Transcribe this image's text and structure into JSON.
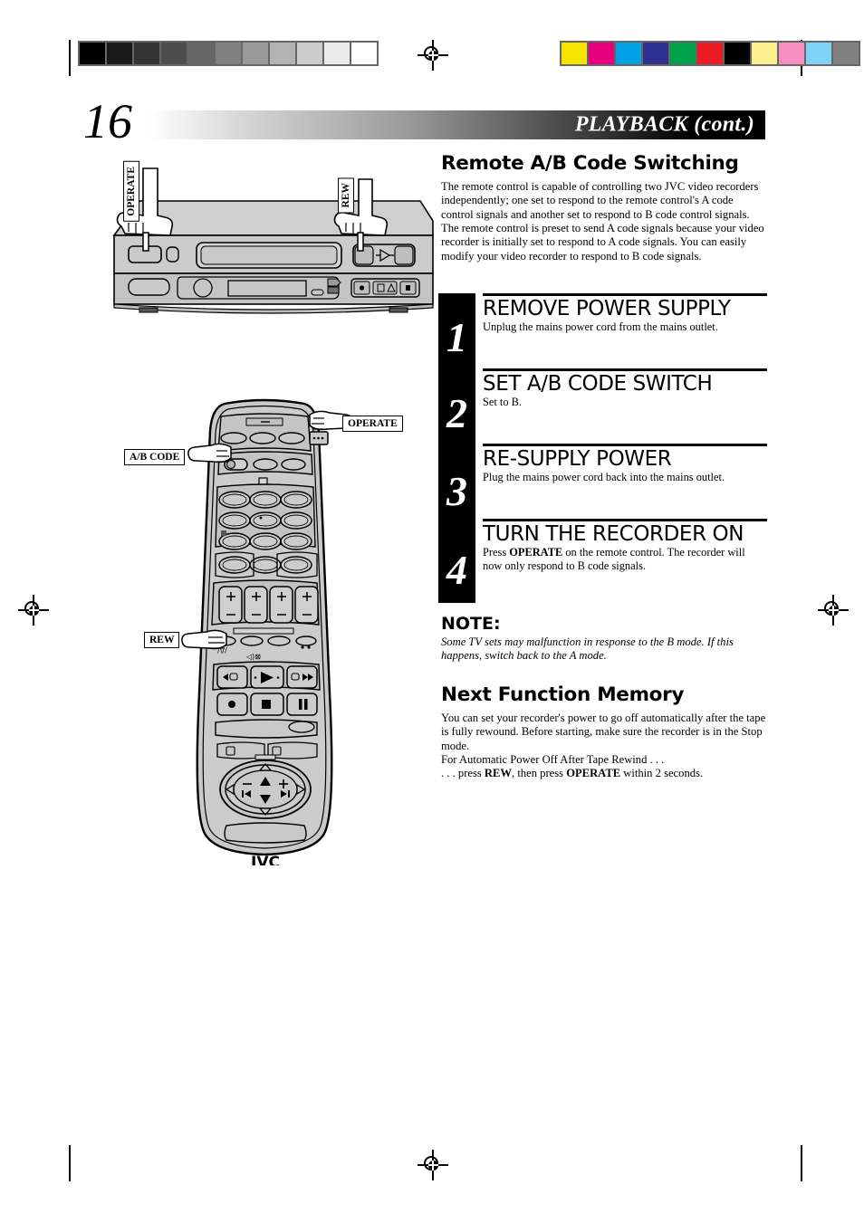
{
  "page": {
    "number": "16",
    "header_title": "PLAYBACK (cont.)"
  },
  "calibration": {
    "grayscale_patches": [
      "#000000",
      "#1a1a1a",
      "#333333",
      "#4d4d4d",
      "#666666",
      "#808080",
      "#999999",
      "#b3b3b3",
      "#cccccc",
      "#ebebeb",
      "#ffffff"
    ],
    "color_patches": [
      "#f5e400",
      "#e6007e",
      "#00a0e4",
      "#2e3192",
      "#00a14b",
      "#ed1c24",
      "#000000",
      "#faef8c",
      "#f48fc0",
      "#7ed3f7",
      "#808080"
    ]
  },
  "sections": {
    "remote_ab": {
      "title": "Remote A/B Code Switching",
      "body": "The remote control is capable of controlling two JVC video recorders independently; one set to respond to the remote control's A code control signals and another set to respond to B code control signals. The remote control is preset to send A code signals because your video recorder is initially set to respond to A code signals. You can easily modify your video recorder to respond to B code signals."
    },
    "steps": [
      {
        "number": "1",
        "heading": "REMOVE POWER SUPPLY",
        "description": "Unplug the mains power cord from the mains outlet."
      },
      {
        "number": "2",
        "heading": "SET A/B CODE SWITCH",
        "description": "Set to B."
      },
      {
        "number": "3",
        "heading": "RE-SUPPLY POWER",
        "description": "Plug the mains power cord back into the mains outlet."
      },
      {
        "number": "4",
        "heading": "TURN THE RECORDER ON",
        "description_pre": "Press ",
        "description_bold": "OPERATE",
        "description_post": " on the remote control. The recorder will now only respond to B code signals."
      }
    ],
    "note": {
      "heading": "NOTE:",
      "body": "Some TV sets may malfunction in response to the B mode. If this happens, switch back to the A mode."
    },
    "next_function_memory": {
      "title": "Next Function Memory",
      "body": "You can set your recorder's power to go off automatically after the tape is fully rewound. Before starting, make sure the recorder is in the Stop mode.",
      "line_auto": "For Automatic Power Off After Tape Rewind . . .",
      "line_press_pre": ". . . press ",
      "line_press_b1": "REW",
      "line_press_mid": ", then press ",
      "line_press_b2": "OPERATE",
      "line_press_post": " within 2 seconds."
    }
  },
  "illustrations": {
    "vcr": {
      "callout_operate": "OPERATE",
      "callout_rew": "REW"
    },
    "remote": {
      "callout_operate": "OPERATE",
      "callout_ab_code": "A/B CODE",
      "callout_rew": "REW",
      "brand": "JVC"
    }
  }
}
